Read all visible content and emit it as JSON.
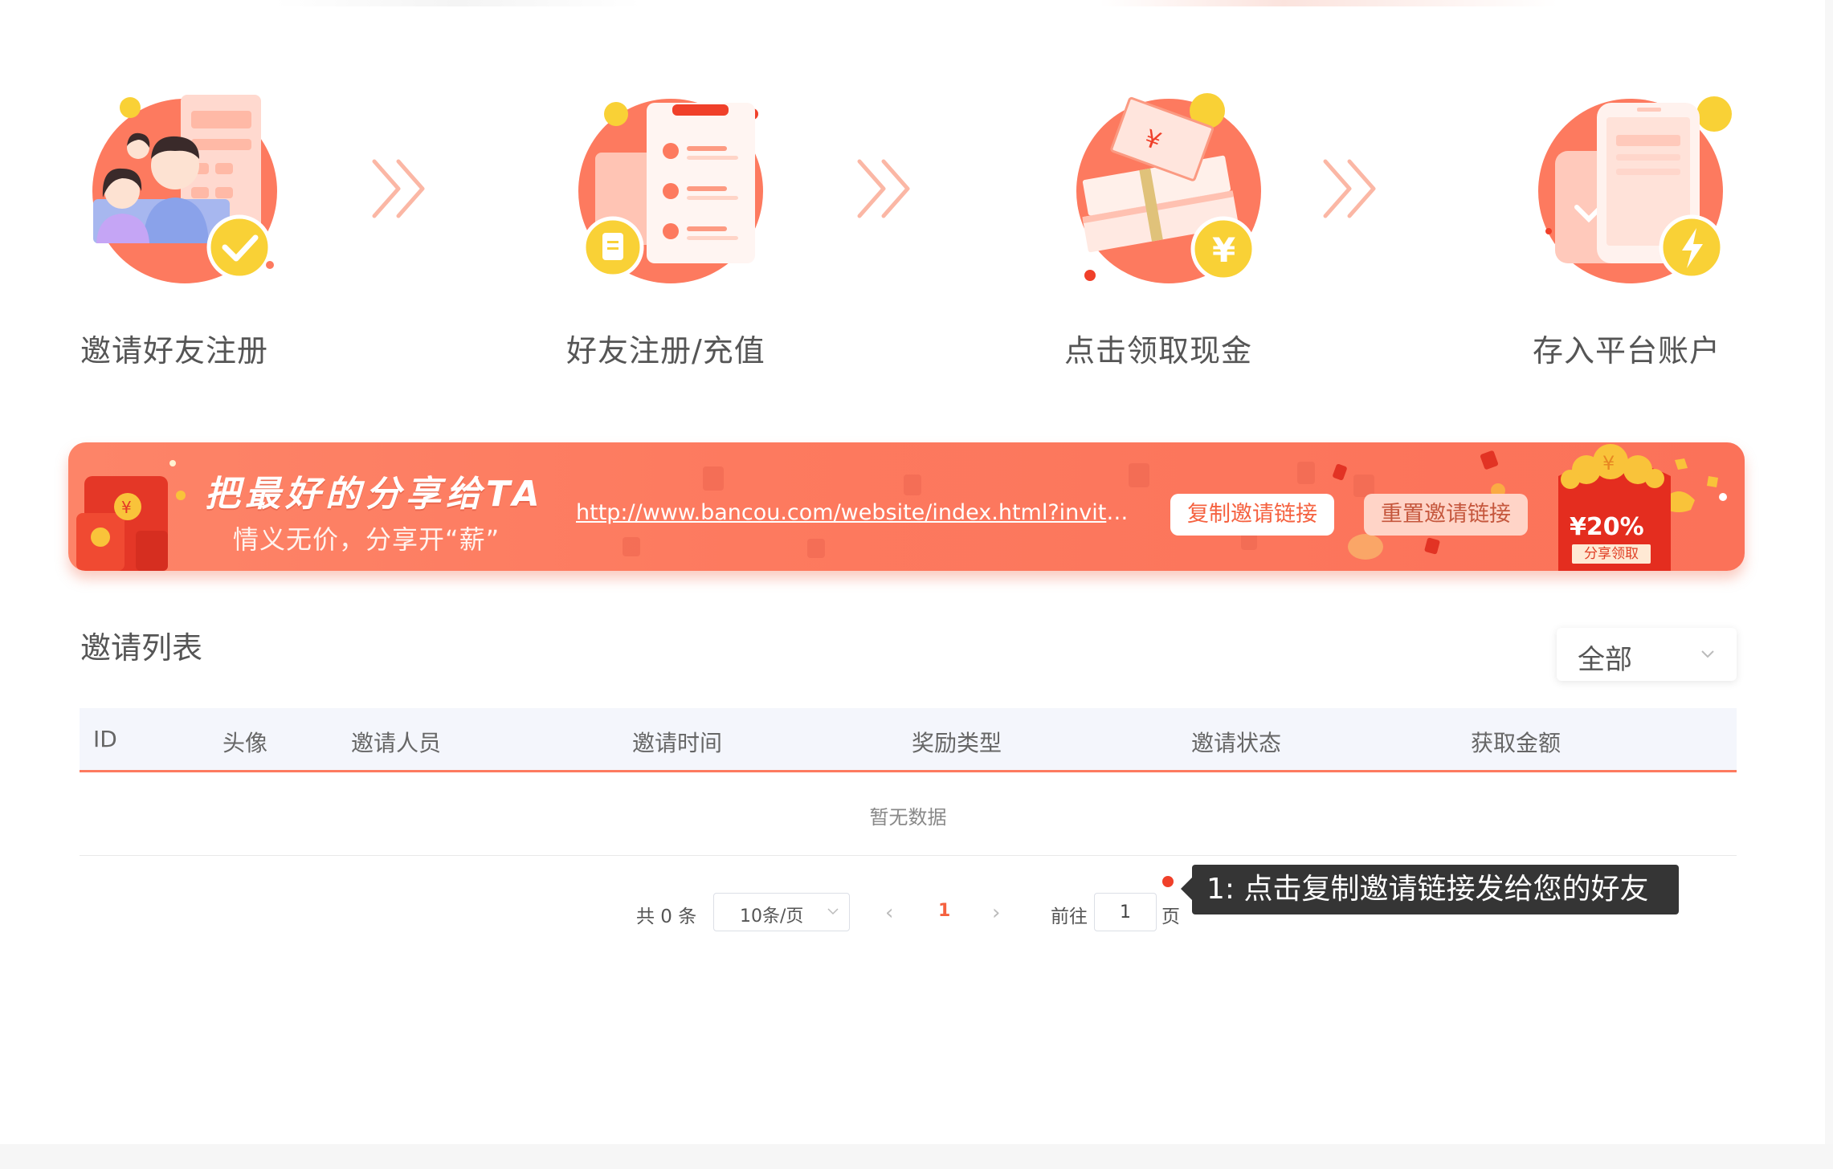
{
  "steps": [
    {
      "label": "邀请好友注册",
      "icon": "invite-friends-icon"
    },
    {
      "label": "好友注册/充值",
      "icon": "register-form-icon"
    },
    {
      "label": "点击领取现金",
      "icon": "cash-stack-icon"
    },
    {
      "label": "存入平台账户",
      "icon": "phone-deposit-icon"
    }
  ],
  "banner": {
    "title": "把最好的分享给TA",
    "subtitle": "情义无价，分享开“薪”",
    "link": "http://www.bancou.com/website/index.html?inviteC...",
    "copy_label": "复制邀请链接",
    "reset_label": "重置邀请链接",
    "reward_percent": "¥20%",
    "reward_caption": "分享领取"
  },
  "list": {
    "title": "邀请列表",
    "filter_value": "全部",
    "columns": [
      "ID",
      "头像",
      "邀请人员",
      "邀请时间",
      "奖励类型",
      "邀请状态",
      "获取金额"
    ],
    "empty_text": "暂无数据"
  },
  "pagination": {
    "total": "共 0 条",
    "page_size": "10条/页",
    "prev": "‹",
    "current_page": "1",
    "next": "›",
    "goto_label": "前往",
    "goto_value": "1",
    "page_unit": "页"
  },
  "tooltip": {
    "text": "1:  点击复制邀请链接发给您的好友"
  },
  "colors": {
    "accent": "#fd7a5f",
    "accent_dark": "#f5613f",
    "yellow": "#f9d136"
  }
}
